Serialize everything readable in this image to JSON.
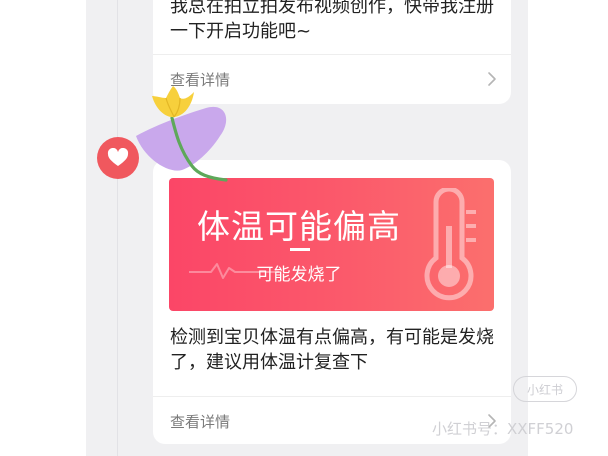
{
  "feed": {
    "cards": [
      {
        "text": "我总在拍立拍发布视频创作，快带我注册一下开启功能吧~",
        "detail_label": "查看详情"
      },
      {
        "banner": {
          "title": "体温可能偏高",
          "subtitle": "可能发烧了"
        },
        "text": "检测到宝贝体温有点偏高，有可能是发烧了，建议用体温计复查下",
        "detail_label": "查看详情"
      }
    ]
  },
  "watermark": {
    "logo": "小红书",
    "id": "小红书号：XXFF520"
  },
  "icons": {
    "heart": "heart-icon",
    "flower": "tulip-flower-sticker",
    "thermometer": "thermometer-icon",
    "chevron": "chevron-right-icon",
    "heartbeat": "heartbeat-line-icon"
  },
  "colors": {
    "banner_start": "#fb4667",
    "banner_end": "#fb6f6d",
    "heart_badge": "#f0585e",
    "feed_background": "#f0f0f2"
  }
}
